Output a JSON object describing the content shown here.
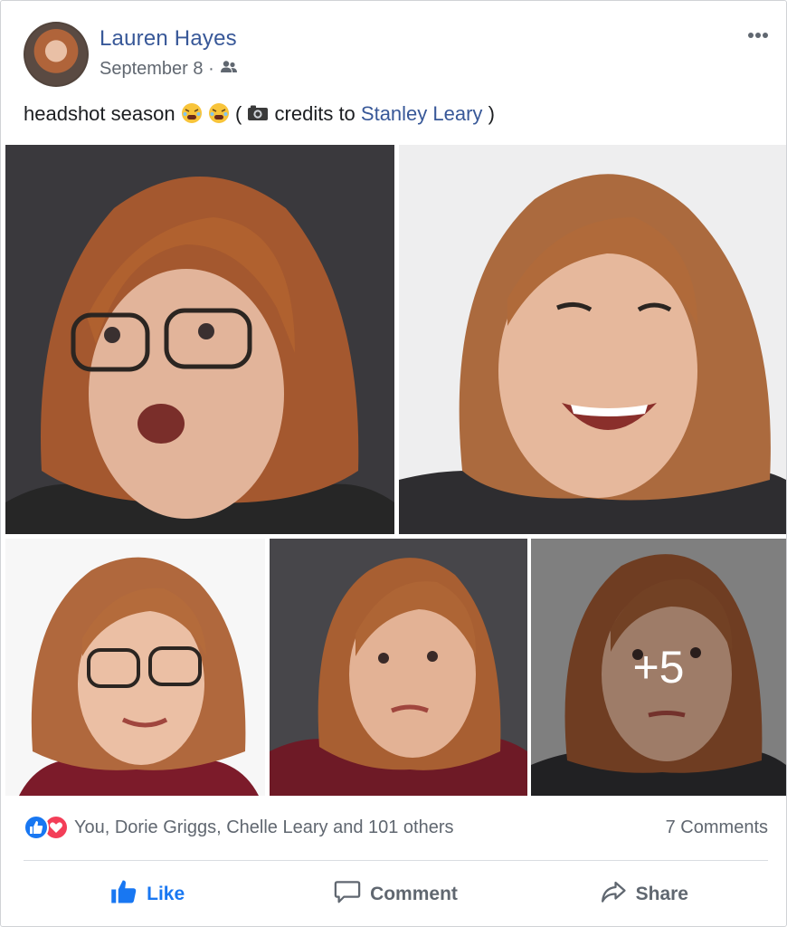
{
  "post": {
    "author": "Lauren Hayes",
    "date": "September 8 ·",
    "privacy_icon": "friends-icon",
    "caption_prefix": "headshot season",
    "caption_mid": " (",
    "caption_mid2": " credits to ",
    "caption_link": "Stanley Leary",
    "caption_suffix": ")"
  },
  "photos": {
    "more_count": "+5"
  },
  "stats": {
    "reactions_text": "You, Dorie Griggs, Chelle Leary and 101 others",
    "comments_text": "7 Comments"
  },
  "actions": {
    "like": "Like",
    "comment": "Comment",
    "share": "Share"
  },
  "colors": {
    "link": "#385898",
    "like_blue": "#1877f2",
    "love_red": "#f33e58",
    "muted": "#606770"
  }
}
